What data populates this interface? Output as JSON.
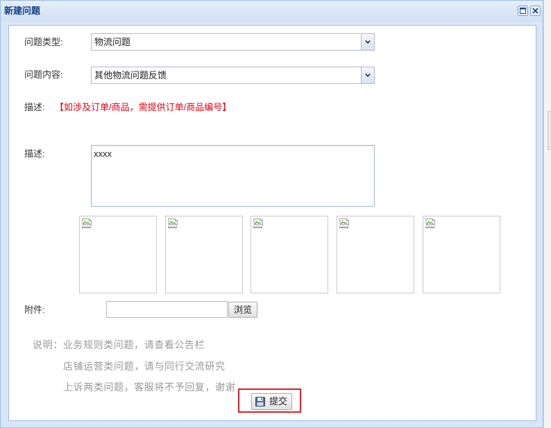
{
  "window": {
    "title": "新建问题",
    "tools": [
      "maximize-icon",
      "close-icon"
    ]
  },
  "form": {
    "issue_type": {
      "label": "问题类型:",
      "selected": "物流问题",
      "icon": "chevron-down-icon"
    },
    "issue_content": {
      "label": "问题内容:",
      "selected": "其他物流问题反馈",
      "icon": "chevron-down-icon"
    },
    "description_hint": {
      "label": "描述:",
      "hint": "【如涉及订单/商品，需提供订单/商品编号】"
    },
    "description": {
      "label": "描述:",
      "value": "xxxx"
    },
    "image_slots": [
      {
        "icon": "broken-image-icon"
      },
      {
        "icon": "broken-image-icon"
      },
      {
        "icon": "broken-image-icon"
      },
      {
        "icon": "broken-image-icon"
      },
      {
        "icon": "broken-image-icon"
      }
    ],
    "attachment": {
      "label": "附件:",
      "value": "",
      "browse_label": "浏览"
    },
    "notes": [
      "说明：业务规则类问题，请查看公告栏",
      "店铺运营类问题，请与同行交流研究",
      "上诉两类问题，客服将不予回复，谢谢"
    ],
    "submit": {
      "label": "提交",
      "icon": "save-icon"
    }
  },
  "colors": {
    "title_text": "#15428b",
    "window_border": "#99bbe8",
    "hint_text": "#e60012",
    "note_text": "#999999",
    "highlight_border": "#d9202a"
  }
}
